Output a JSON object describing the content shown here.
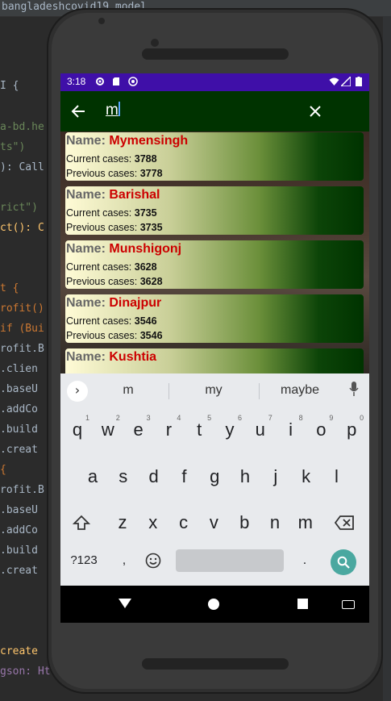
{
  "ide": {
    "tab_title": "bangladeshcovid19_model",
    "lines": [
      "I {",
      "a-bd.he",
      "ts\")",
      "): Call",
      "rict\")",
      "ct(): C",
      "t {",
      "rofit()",
      "if (Bui",
      "rofit.B",
      ".clien",
      ".baseU",
      ".addCo",
      ".build",
      ".creat",
      "{",
      "rofit.B",
      ".baseU",
      ".addCo",
      ".build",
      ".creat",
      "create",
      "gson: Htt"
    ]
  },
  "status_bar": {
    "time": "3:18",
    "icons": [
      "settings-icon",
      "sd-card-icon",
      "sync-icon",
      "wifi-icon",
      "signal-icon",
      "battery-icon"
    ]
  },
  "search": {
    "query": "m",
    "back_icon": "arrow-left-icon",
    "clear_icon": "close-icon"
  },
  "labels": {
    "name": "Name:",
    "current": "Current cases:",
    "previous": "Previous cases:"
  },
  "districts": [
    {
      "name": "Mymensingh",
      "current": "3788",
      "previous": "3778"
    },
    {
      "name": "Barishal",
      "current": "3735",
      "previous": "3735"
    },
    {
      "name": "Munshigonj",
      "current": "3628",
      "previous": "3628"
    },
    {
      "name": "Dinajpur",
      "current": "3546",
      "previous": "3546"
    },
    {
      "name": "Kushtia",
      "current": "",
      "previous": ""
    }
  ],
  "keyboard": {
    "suggestions": [
      "m",
      "my",
      "maybe"
    ],
    "row1": [
      {
        "k": "q",
        "s": "1"
      },
      {
        "k": "w",
        "s": "2"
      },
      {
        "k": "e",
        "s": "3"
      },
      {
        "k": "r",
        "s": "4"
      },
      {
        "k": "t",
        "s": "5"
      },
      {
        "k": "y",
        "s": "6"
      },
      {
        "k": "u",
        "s": "7"
      },
      {
        "k": "i",
        "s": "8"
      },
      {
        "k": "o",
        "s": "9"
      },
      {
        "k": "p",
        "s": "0"
      }
    ],
    "row2": [
      "a",
      "s",
      "d",
      "f",
      "g",
      "h",
      "j",
      "k",
      "l"
    ],
    "row3": [
      "z",
      "x",
      "c",
      "v",
      "b",
      "n",
      "m"
    ],
    "symbols_label": "?123",
    "comma": ",",
    "period": ".",
    "shift_icon": "shift-icon",
    "backspace_icon": "backspace-icon",
    "emoji_icon": "emoji-icon",
    "enter_icon": "search-icon",
    "mic_icon": "mic-icon"
  },
  "nav": {
    "back_icon": "nav-back-icon",
    "home_icon": "nav-home-icon",
    "recents_icon": "nav-recents-icon",
    "keyboard_icon": "keyboard-switch-icon"
  }
}
